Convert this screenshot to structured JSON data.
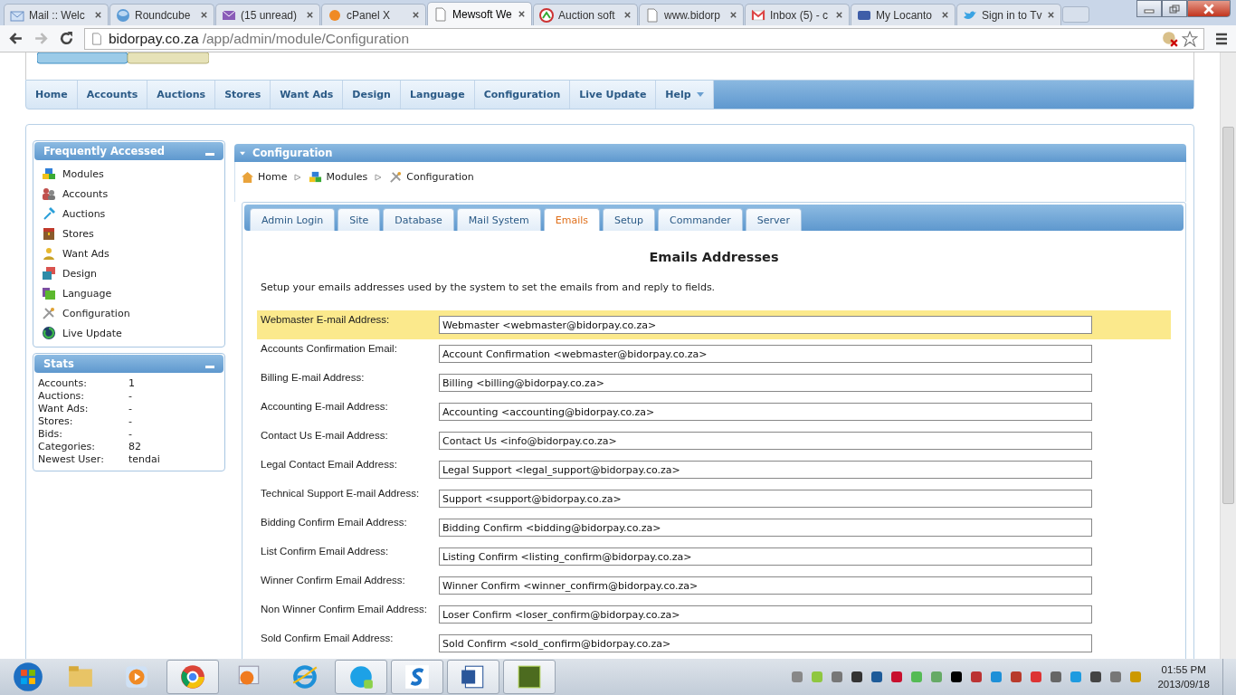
{
  "browser": {
    "tabs": [
      {
        "title": "Mail :: Welc",
        "selected": false
      },
      {
        "title": "Roundcube",
        "selected": false
      },
      {
        "title": "(15 unread)",
        "selected": false
      },
      {
        "title": "cPanel X",
        "selected": false
      },
      {
        "title": "Mewsoft We",
        "selected": true
      },
      {
        "title": "Auction soft",
        "selected": false
      },
      {
        "title": "www.bidorp",
        "selected": false
      },
      {
        "title": "Inbox (5) - c",
        "selected": false
      },
      {
        "title": "My Locanto",
        "selected": false
      },
      {
        "title": "Sign in to Tv",
        "selected": false
      }
    ],
    "address": {
      "host": "bidorpay.co.za",
      "path": "/app/admin/module/Configuration"
    }
  },
  "nav": [
    {
      "label": "Home",
      "has_menu": false
    },
    {
      "label": "Accounts",
      "has_menu": false
    },
    {
      "label": "Auctions",
      "has_menu": false
    },
    {
      "label": "Stores",
      "has_menu": false
    },
    {
      "label": "Want Ads",
      "has_menu": false
    },
    {
      "label": "Design",
      "has_menu": false
    },
    {
      "label": "Language",
      "has_menu": false
    },
    {
      "label": "Configuration",
      "has_menu": false
    },
    {
      "label": "Live Update",
      "has_menu": false
    },
    {
      "label": "Help",
      "has_menu": true
    }
  ],
  "sidebar": {
    "frequent": {
      "title": "Frequently Accessed",
      "items": [
        "Modules",
        "Accounts",
        "Auctions",
        "Stores",
        "Want Ads",
        "Design",
        "Language",
        "Configuration",
        "Live Update"
      ]
    },
    "stats": {
      "title": "Stats",
      "rows": [
        {
          "label": "Accounts:",
          "value": "1"
        },
        {
          "label": "Auctions:",
          "value": "-"
        },
        {
          "label": "Want Ads:",
          "value": "-"
        },
        {
          "label": "Stores:",
          "value": "-"
        },
        {
          "label": "Bids:",
          "value": "-"
        },
        {
          "label": "Categories:",
          "value": "82"
        },
        {
          "label": "Newest User:",
          "value": "tendai"
        }
      ]
    }
  },
  "panel": {
    "title": "Configuration",
    "breadcrumbs": [
      "Home",
      "Modules",
      "Configuration"
    ],
    "tabs": [
      {
        "label": "Admin Login",
        "selected": false
      },
      {
        "label": "Site",
        "selected": false
      },
      {
        "label": "Database",
        "selected": false
      },
      {
        "label": "Mail System",
        "selected": false
      },
      {
        "label": "Emails",
        "selected": true
      },
      {
        "label": "Setup",
        "selected": false
      },
      {
        "label": "Commander",
        "selected": false
      },
      {
        "label": "Server",
        "selected": false
      }
    ],
    "heading": "Emails Addresses",
    "description": "Setup your emails addresses used by the system to set the emails from and reply to fields.",
    "fields": [
      {
        "label": "Webmaster E-mail Address:",
        "value": "Webmaster <webmaster@bidorpay.co.za>",
        "highlighted": true
      },
      {
        "label": "Accounts Confirmation Email:",
        "value": "Account Confirmation <webmaster@bidorpay.co.za>",
        "highlighted": false
      },
      {
        "label": "Billing E-mail Address:",
        "value": "Billing <billing@bidorpay.co.za>",
        "highlighted": false
      },
      {
        "label": "Accounting E-mail Address:",
        "value": "Accounting <accounting@bidorpay.co.za>",
        "highlighted": false
      },
      {
        "label": "Contact Us E-mail Address:",
        "value": "Contact Us <info@bidorpay.co.za>",
        "highlighted": false
      },
      {
        "label": "Legal Contact Email Address:",
        "value": "Legal Support <legal_support@bidorpay.co.za>",
        "highlighted": false
      },
      {
        "label": "Technical Support E-mail Address:",
        "value": "Support <support@bidorpay.co.za>",
        "highlighted": false
      },
      {
        "label": "Bidding Confirm Email Address:",
        "value": "Bidding Confirm <bidding@bidorpay.co.za>",
        "highlighted": false
      },
      {
        "label": "List Confirm Email Address:",
        "value": "Listing Confirm <listing_confirm@bidorpay.co.za>",
        "highlighted": false
      },
      {
        "label": "Winner Confirm Email Address:",
        "value": "Winner Confirm <winner_confirm@bidorpay.co.za>",
        "highlighted": false
      },
      {
        "label": "Non Winner Confirm Email Address:",
        "value": "Loser Confirm <loser_confirm@bidorpay.co.za>",
        "highlighted": false
      },
      {
        "label": "Sold Confirm Email Address:",
        "value": "Sold Confirm <sold_confirm@bidorpay.co.za>",
        "highlighted": false
      }
    ]
  },
  "taskbar": {
    "time": "01:55 PM",
    "date": "2013/09/18"
  }
}
